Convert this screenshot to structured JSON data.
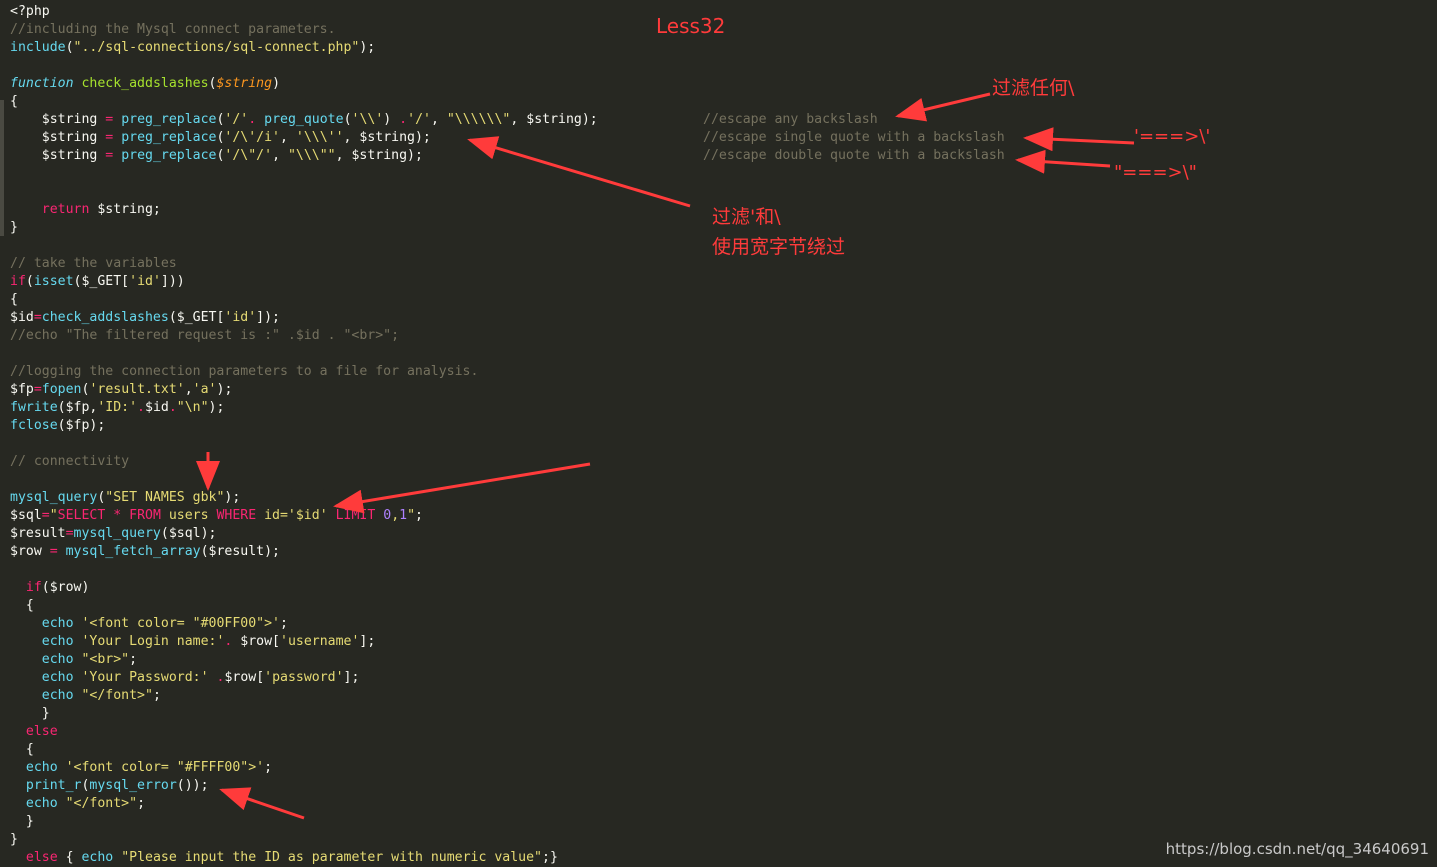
{
  "title": "Less32",
  "colors": {
    "background": "#272822",
    "default": "#f8f8f2",
    "comment": "#75715e",
    "keyword": "#f92672",
    "function": "#66d9ef",
    "string": "#e6db74",
    "number": "#ae81ff",
    "param": "#fd971f",
    "annotation": "#ff3b3b"
  },
  "code_lines": [
    [
      [
        "d",
        "<?php"
      ]
    ],
    [
      [
        "c",
        "//including the Mysql connect parameters."
      ]
    ],
    [
      [
        "f",
        "include"
      ],
      [
        "d",
        "("
      ],
      [
        "s",
        "\"../sql-connections/sql-connect.php\""
      ],
      [
        "d",
        ");"
      ]
    ],
    [],
    [
      [
        "fi",
        "function"
      ],
      [
        "d",
        " "
      ],
      [
        "g",
        "check_addslashes"
      ],
      [
        "d",
        "("
      ],
      [
        "p",
        "$string"
      ],
      [
        "d",
        ")"
      ]
    ],
    [
      [
        "d",
        "{"
      ]
    ],
    [
      [
        "d",
        "    $string "
      ],
      [
        "k",
        "="
      ],
      [
        "d",
        " "
      ],
      [
        "f",
        "preg_replace"
      ],
      [
        "d",
        "("
      ],
      [
        "s",
        "'/'"
      ],
      [
        "k",
        "."
      ],
      [
        "d",
        " "
      ],
      [
        "f",
        "preg_quote"
      ],
      [
        "d",
        "("
      ],
      [
        "s",
        "'\\\\'"
      ],
      [
        "d",
        ") "
      ],
      [
        "k",
        "."
      ],
      [
        "s",
        "'/'"
      ],
      [
        "d",
        ", "
      ],
      [
        "s",
        "\"\\\\\\\\\\\\\""
      ],
      [
        "d",
        ", $string);"
      ],
      [
        "pad",
        ""
      ],
      [
        "c",
        "//escape any backslash"
      ]
    ],
    [
      [
        "d",
        "    $string "
      ],
      [
        "k",
        "="
      ],
      [
        "d",
        " "
      ],
      [
        "f",
        "preg_replace"
      ],
      [
        "d",
        "("
      ],
      [
        "s",
        "'/\\'/i'"
      ],
      [
        "d",
        ", "
      ],
      [
        "s",
        "'\\\\\\''"
      ],
      [
        "d",
        ", $string);"
      ],
      [
        "pad",
        ""
      ],
      [
        "c",
        "//escape single quote with a backslash"
      ]
    ],
    [
      [
        "d",
        "    $string "
      ],
      [
        "k",
        "="
      ],
      [
        "d",
        " "
      ],
      [
        "f",
        "preg_replace"
      ],
      [
        "d",
        "("
      ],
      [
        "s",
        "'/\\\"/'"
      ],
      [
        "d",
        ", "
      ],
      [
        "s",
        "\"\\\\\\\"\""
      ],
      [
        "d",
        ", $string);"
      ],
      [
        "pad",
        ""
      ],
      [
        "c",
        "//escape double quote with a backslash"
      ]
    ],
    [],
    [],
    [
      [
        "d",
        "    "
      ],
      [
        "k",
        "return"
      ],
      [
        "d",
        " $string;"
      ]
    ],
    [
      [
        "d",
        "}"
      ]
    ],
    [],
    [
      [
        "c",
        "// take the variables"
      ]
    ],
    [
      [
        "k",
        "if"
      ],
      [
        "d",
        "("
      ],
      [
        "f",
        "isset"
      ],
      [
        "d",
        "($_GET["
      ],
      [
        "s",
        "'id'"
      ],
      [
        "d",
        "]))"
      ]
    ],
    [
      [
        "d",
        "{"
      ]
    ],
    [
      [
        "d",
        "$id"
      ],
      [
        "k",
        "="
      ],
      [
        "f",
        "check_addslashes"
      ],
      [
        "d",
        "($_GET["
      ],
      [
        "s",
        "'id'"
      ],
      [
        "d",
        "]);"
      ]
    ],
    [
      [
        "c",
        "//echo \"The filtered request is :\" .$id . \"<br>\";"
      ]
    ],
    [],
    [
      [
        "c",
        "//logging the connection parameters to a file for analysis."
      ]
    ],
    [
      [
        "d",
        "$fp"
      ],
      [
        "k",
        "="
      ],
      [
        "f",
        "fopen"
      ],
      [
        "d",
        "("
      ],
      [
        "s",
        "'result.txt'"
      ],
      [
        "d",
        ","
      ],
      [
        "s",
        "'a'"
      ],
      [
        "d",
        ");"
      ]
    ],
    [
      [
        "f",
        "fwrite"
      ],
      [
        "d",
        "($fp,"
      ],
      [
        "s",
        "'ID:'"
      ],
      [
        "k",
        "."
      ],
      [
        "d",
        "$id"
      ],
      [
        "k",
        "."
      ],
      [
        "s",
        "\"\\n\""
      ],
      [
        "d",
        ");"
      ]
    ],
    [
      [
        "f",
        "fclose"
      ],
      [
        "d",
        "($fp);"
      ]
    ],
    [],
    [
      [
        "c",
        "// connectivity"
      ]
    ],
    [],
    [
      [
        "f",
        "mysql_query"
      ],
      [
        "d",
        "("
      ],
      [
        "s",
        "\"SET NAMES gbk\""
      ],
      [
        "d",
        ");"
      ]
    ],
    [
      [
        "d",
        "$sql"
      ],
      [
        "k",
        "="
      ],
      [
        "s",
        "\""
      ],
      [
        "k",
        "SELECT * FROM"
      ],
      [
        "s",
        " users "
      ],
      [
        "k",
        "WHERE"
      ],
      [
        "s",
        " id='$id' "
      ],
      [
        "k",
        "LIMIT"
      ],
      [
        "s",
        " "
      ],
      [
        "n",
        "0"
      ],
      [
        "s",
        ","
      ],
      [
        "n",
        "1"
      ],
      [
        "s",
        "\""
      ],
      [
        "d",
        ";"
      ]
    ],
    [
      [
        "d",
        "$result"
      ],
      [
        "k",
        "="
      ],
      [
        "f",
        "mysql_query"
      ],
      [
        "d",
        "($sql);"
      ]
    ],
    [
      [
        "d",
        "$row "
      ],
      [
        "k",
        "="
      ],
      [
        "d",
        " "
      ],
      [
        "f",
        "mysql_fetch_array"
      ],
      [
        "d",
        "($result);"
      ]
    ],
    [],
    [
      [
        "d",
        "  "
      ],
      [
        "k",
        "if"
      ],
      [
        "d",
        "($row)"
      ]
    ],
    [
      [
        "d",
        "  {"
      ]
    ],
    [
      [
        "d",
        "    "
      ],
      [
        "f",
        "echo"
      ],
      [
        "d",
        " "
      ],
      [
        "s",
        "'<font color= \"#00FF00\">'"
      ],
      [
        "d",
        ";"
      ]
    ],
    [
      [
        "d",
        "    "
      ],
      [
        "f",
        "echo"
      ],
      [
        "d",
        " "
      ],
      [
        "s",
        "'Your Login name:'"
      ],
      [
        "k",
        "."
      ],
      [
        "d",
        " $row["
      ],
      [
        "s",
        "'username'"
      ],
      [
        "d",
        "];"
      ]
    ],
    [
      [
        "d",
        "    "
      ],
      [
        "f",
        "echo"
      ],
      [
        "d",
        " "
      ],
      [
        "s",
        "\"<br>\""
      ],
      [
        "d",
        ";"
      ]
    ],
    [
      [
        "d",
        "    "
      ],
      [
        "f",
        "echo"
      ],
      [
        "d",
        " "
      ],
      [
        "s",
        "'Your Password:'"
      ],
      [
        "d",
        " "
      ],
      [
        "k",
        "."
      ],
      [
        "d",
        "$row["
      ],
      [
        "s",
        "'password'"
      ],
      [
        "d",
        "];"
      ]
    ],
    [
      [
        "d",
        "    "
      ],
      [
        "f",
        "echo"
      ],
      [
        "d",
        " "
      ],
      [
        "s",
        "\"</font>\""
      ],
      [
        "d",
        ";"
      ]
    ],
    [
      [
        "d",
        "    }"
      ]
    ],
    [
      [
        "d",
        "  "
      ],
      [
        "k",
        "else"
      ]
    ],
    [
      [
        "d",
        "  {"
      ]
    ],
    [
      [
        "d",
        "  "
      ],
      [
        "f",
        "echo"
      ],
      [
        "d",
        " "
      ],
      [
        "s",
        "'<font color= \"#FFFF00\">'"
      ],
      [
        "d",
        ";"
      ]
    ],
    [
      [
        "d",
        "  "
      ],
      [
        "f",
        "print_r"
      ],
      [
        "d",
        "("
      ],
      [
        "f",
        "mysql_error"
      ],
      [
        "d",
        "());"
      ]
    ],
    [
      [
        "d",
        "  "
      ],
      [
        "f",
        "echo"
      ],
      [
        "d",
        " "
      ],
      [
        "s",
        "\"</font>\""
      ],
      [
        "d",
        ";"
      ]
    ],
    [
      [
        "d",
        "  }"
      ]
    ],
    [
      [
        "d",
        "}"
      ]
    ],
    [
      [
        "d",
        "  "
      ],
      [
        "k",
        "else"
      ],
      [
        "d",
        " { "
      ],
      [
        "f",
        "echo"
      ],
      [
        "d",
        " "
      ],
      [
        "s",
        "\"Please input the ID as parameter with numeric value\""
      ],
      [
        "d",
        ";}"
      ]
    ]
  ],
  "annotations": {
    "filter_any": "过滤任何\\",
    "filter_quote_l1": "过滤'和\\",
    "filter_quote_l2": "使用宽字节绕过",
    "single_quote": "'===>\\'",
    "double_quote": "\"===>\\\""
  },
  "watermark": "https://blog.csdn.net/qq_34640691"
}
